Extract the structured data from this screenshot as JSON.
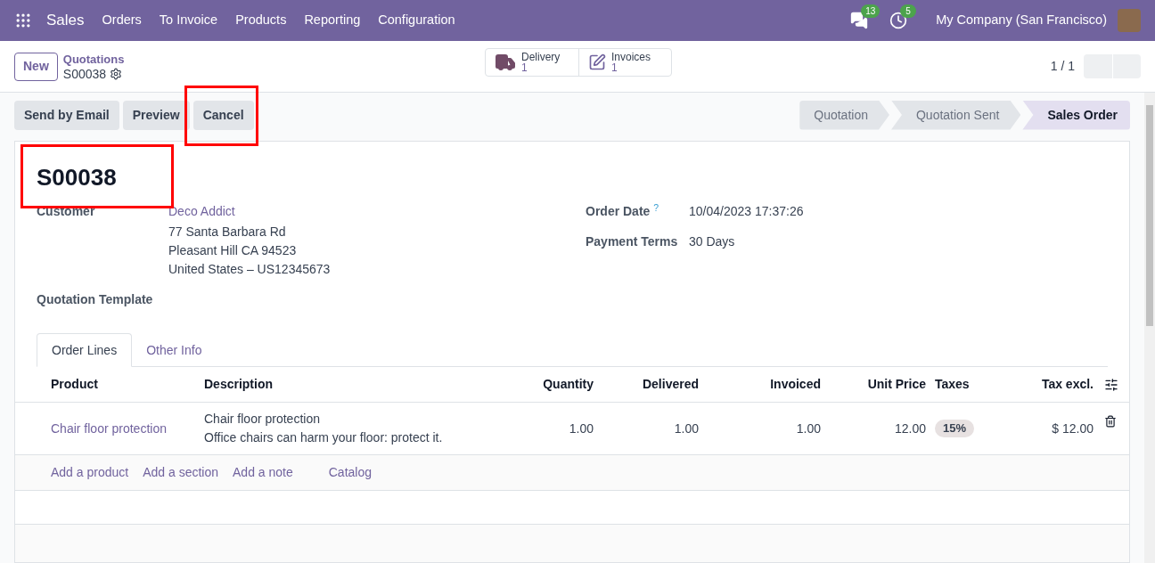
{
  "app": {
    "name": "Sales",
    "menu": [
      "Orders",
      "To Invoice",
      "Products",
      "Reporting",
      "Configuration"
    ]
  },
  "systray": {
    "messages_count": "13",
    "activities_count": "5",
    "company": "My Company (San Francisco)"
  },
  "control_panel": {
    "new_button": "New",
    "breadcrumb": "Quotations",
    "record": "S00038",
    "pager": "1 / 1",
    "smart_buttons": [
      {
        "label": "Delivery",
        "count": "1",
        "kind": "truck"
      },
      {
        "label": "Invoices",
        "count": "1",
        "kind": "edit"
      }
    ]
  },
  "actions": [
    "Send by Email",
    "Preview",
    "Cancel"
  ],
  "status_bar": [
    {
      "label": "Quotation",
      "selected": false
    },
    {
      "label": "Quotation Sent",
      "selected": false
    },
    {
      "label": "Sales Order",
      "selected": true
    }
  ],
  "sheet": {
    "title": "S00038",
    "customer": {
      "label": "Customer",
      "name": "Deco Addict",
      "address": [
        "77 Santa Barbara Rd",
        "Pleasant Hill CA 94523",
        "United States – US12345673"
      ]
    },
    "quotation_template": {
      "label": "Quotation Template"
    },
    "order_date": {
      "label": "Order Date",
      "help": "?",
      "value": "10/04/2023 17:37:26"
    },
    "payment_terms": {
      "label": "Payment Terms",
      "value": "30 Days"
    }
  },
  "tabs": [
    {
      "label": "Order Lines",
      "selected": true
    },
    {
      "label": "Other Info",
      "selected": false
    }
  ],
  "table": {
    "columns": [
      "Product",
      "Description",
      "Quantity",
      "Delivered",
      "Invoiced",
      "Unit Price",
      "Taxes",
      "Tax excl."
    ],
    "rows": [
      {
        "product": "Chair floor protection",
        "description": [
          "Chair floor protection",
          "Office chairs can harm your floor: protect it."
        ],
        "quantity": "1.00",
        "delivered": "1.00",
        "invoiced": "1.00",
        "unit_price": "12.00",
        "taxes": [
          "15%"
        ],
        "subtotal": "$ 12.00"
      }
    ],
    "add_links": [
      "Add a product",
      "Add a section",
      "Add a note",
      "Catalog"
    ]
  }
}
